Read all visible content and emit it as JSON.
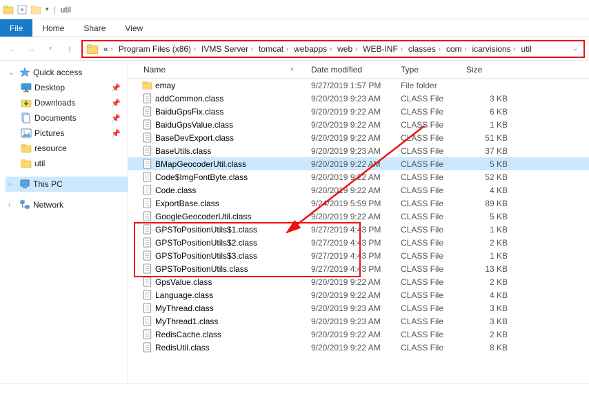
{
  "window": {
    "title": "util"
  },
  "tabs": {
    "file": "File",
    "home": "Home",
    "share": "Share",
    "view": "View"
  },
  "breadcrumb": [
    "Program Files (x86)",
    "IVMS Server",
    "tomcat",
    "webapps",
    "web",
    "WEB-INF",
    "classes",
    "com",
    "icarvisions",
    "util"
  ],
  "breadcrumb_overflow": "«",
  "tree": {
    "quick": "Quick access",
    "items": [
      "Desktop",
      "Downloads",
      "Documents",
      "Pictures",
      "resource",
      "util"
    ],
    "thispc": "This PC",
    "network": "Network"
  },
  "columns": {
    "name": "Name",
    "date": "Date modified",
    "type": "Type",
    "size": "Size"
  },
  "files": [
    {
      "n": "emay",
      "d": "9/27/2019 1:57 PM",
      "t": "File folder",
      "s": "",
      "icon": "folder"
    },
    {
      "n": "addCommon.class",
      "d": "9/20/2019 9:23 AM",
      "t": "CLASS File",
      "s": "3 KB",
      "icon": "file"
    },
    {
      "n": "BaiduGpsFix.class",
      "d": "9/20/2019 9:22 AM",
      "t": "CLASS File",
      "s": "6 KB",
      "icon": "file"
    },
    {
      "n": "BaiduGpsValue.class",
      "d": "9/20/2019 9:22 AM",
      "t": "CLASS File",
      "s": "1 KB",
      "icon": "file"
    },
    {
      "n": "BaseDevExport.class",
      "d": "9/20/2019 9:22 AM",
      "t": "CLASS File",
      "s": "51 KB",
      "icon": "file"
    },
    {
      "n": "BaseUtils.class",
      "d": "9/20/2019 9:23 AM",
      "t": "CLASS File",
      "s": "37 KB",
      "icon": "file"
    },
    {
      "n": "BMapGeocoderUtil.class",
      "d": "9/20/2019 9:22 AM",
      "t": "CLASS File",
      "s": "5 KB",
      "icon": "file",
      "sel": true
    },
    {
      "n": "Code$ImgFontByte.class",
      "d": "9/20/2019 9:22 AM",
      "t": "CLASS File",
      "s": "52 KB",
      "icon": "file"
    },
    {
      "n": "Code.class",
      "d": "9/20/2019 9:22 AM",
      "t": "CLASS File",
      "s": "4 KB",
      "icon": "file"
    },
    {
      "n": "ExportBase.class",
      "d": "9/24/2019 5:59 PM",
      "t": "CLASS File",
      "s": "89 KB",
      "icon": "file"
    },
    {
      "n": "GoogleGeocoderUtil.class",
      "d": "9/20/2019 9:22 AM",
      "t": "CLASS File",
      "s": "5 KB",
      "icon": "file"
    },
    {
      "n": "GPSToPositionUtils$1.class",
      "d": "9/27/2019 4:43 PM",
      "t": "CLASS File",
      "s": "1 KB",
      "icon": "file"
    },
    {
      "n": "GPSToPositionUtils$2.class",
      "d": "9/27/2019 4:43 PM",
      "t": "CLASS File",
      "s": "2 KB",
      "icon": "file"
    },
    {
      "n": "GPSToPositionUtils$3.class",
      "d": "9/27/2019 4:43 PM",
      "t": "CLASS File",
      "s": "1 KB",
      "icon": "file"
    },
    {
      "n": "GPSToPositionUtils.class",
      "d": "9/27/2019 4:43 PM",
      "t": "CLASS File",
      "s": "13 KB",
      "icon": "file"
    },
    {
      "n": "GpsValue.class",
      "d": "9/20/2019 9:22 AM",
      "t": "CLASS File",
      "s": "2 KB",
      "icon": "file"
    },
    {
      "n": "Language.class",
      "d": "9/20/2019 9:22 AM",
      "t": "CLASS File",
      "s": "4 KB",
      "icon": "file"
    },
    {
      "n": "MyThread.class",
      "d": "9/20/2019 9:23 AM",
      "t": "CLASS File",
      "s": "3 KB",
      "icon": "file"
    },
    {
      "n": "MyThread1.class",
      "d": "9/20/2019 9:23 AM",
      "t": "CLASS File",
      "s": "3 KB",
      "icon": "file"
    },
    {
      "n": "RedisCache.class",
      "d": "9/20/2019 9:22 AM",
      "t": "CLASS File",
      "s": "2 KB",
      "icon": "file"
    },
    {
      "n": "RedisUtil.class",
      "d": "9/20/2019 9:22 AM",
      "t": "CLASS File",
      "s": "8 KB",
      "icon": "file"
    }
  ],
  "status": ""
}
